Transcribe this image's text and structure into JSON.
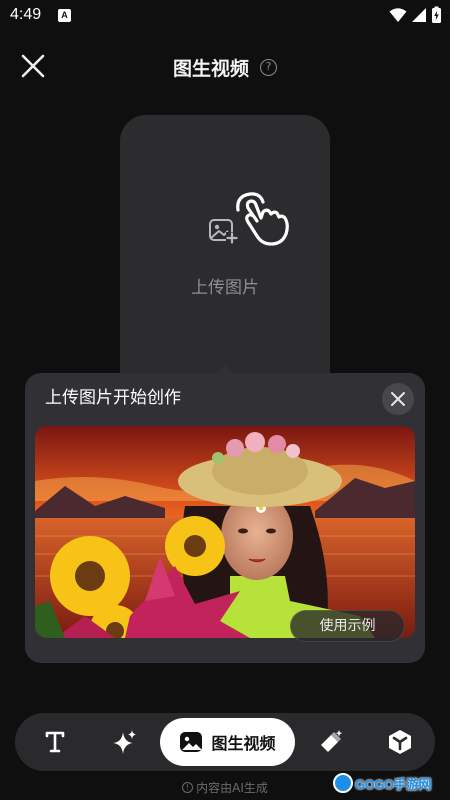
{
  "status_bar": {
    "time": "4:49",
    "notification_letter": "A",
    "icons": [
      "wifi-icon",
      "signal-icon",
      "battery-charging-icon"
    ]
  },
  "header": {
    "title": "图生视频",
    "help_symbol": "?"
  },
  "upload": {
    "label": "上传图片",
    "icons": [
      "add-image-icon",
      "tap-hand-icon"
    ]
  },
  "popup": {
    "title": "上传图片开始创作",
    "sample_button_label": "使用示例",
    "image_description_icon": "sample-photo"
  },
  "toolbar": {
    "items": [
      {
        "name": "text-tool",
        "icon": "text-icon"
      },
      {
        "name": "sparkle-tool",
        "icon": "sparkle-icon"
      },
      {
        "name": "image-to-video",
        "icon": "image-icon",
        "label": "图生视频",
        "active": true
      },
      {
        "name": "magic-eraser-tool",
        "icon": "eraser-icon"
      },
      {
        "name": "cube-tool",
        "icon": "cube-icon"
      }
    ]
  },
  "footer": {
    "info_symbol": "!",
    "note": "内容由AI生成"
  },
  "watermark": {
    "text": "GOGO手游网"
  },
  "colors": {
    "background": "#0f0f10",
    "card": "#2c2c2f",
    "popup": "#313135",
    "toolbar": "#2a2a2d",
    "active_pill": "#ffffff"
  }
}
